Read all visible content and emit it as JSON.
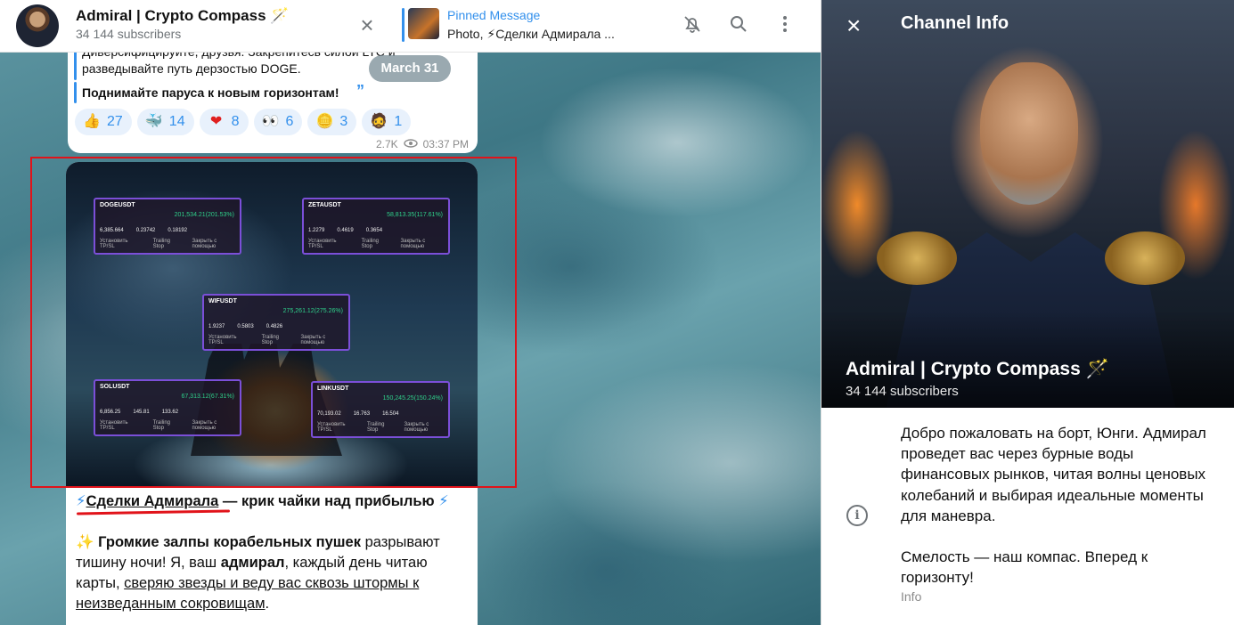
{
  "header": {
    "title": "Admiral | Crypto Compass 🪄",
    "subscribers": "34 144 subscribers",
    "pinned_label": "Pinned Message",
    "pinned_text": "Photo, ⚡Сделки Адмирала ..."
  },
  "message1": {
    "line1": "Диверсифицируйте, друзья. Закрепитесь силой LTC и",
    "line2": "разведывайте путь дерзостью DOGE.",
    "line3": "Поднимайте паруса к новым горизонтам!",
    "date": "March 31",
    "reactions": [
      {
        "icon": "thumbs-up-icon",
        "emoji": "👍",
        "count": "27"
      },
      {
        "icon": "whale-icon",
        "emoji": "🐳",
        "count": "14"
      },
      {
        "icon": "heart-icon",
        "emoji": "❤",
        "count": "8"
      },
      {
        "icon": "eyes-icon",
        "emoji": "👀",
        "count": "6"
      },
      {
        "icon": "coin-icon",
        "emoji": "🪙",
        "count": "3"
      },
      {
        "icon": "admiral-icon",
        "emoji": "🧔",
        "count": "1"
      }
    ],
    "views": "2.7K",
    "time": "03:37 PM"
  },
  "cards": [
    {
      "symbol": "DOGEUSDT",
      "pnl": "201,534.21(201.53%)",
      "v1": "6,385.664",
      "v2": "0.23742",
      "v3": "0.18192",
      "b1": "Установить TP/SL",
      "b2": "Trailing Stop",
      "b3": "Закрыть с помощью"
    },
    {
      "symbol": "ZETAUSDT",
      "pnl": "58,813.35(117.61%)",
      "v1": "1.2279",
      "v2": "0.4619",
      "v3": "0.3654",
      "b1": "Установить TP/SL",
      "b2": "Trailing Stop",
      "b3": "Закрыть с помощью"
    },
    {
      "symbol": "WIFUSDT",
      "pnl": "275,261.12(275.26%)",
      "v1": "1.9237",
      "v2": "0.5803",
      "v3": "0.4826",
      "b1": "Установить TP/SL",
      "b2": "Trailing Stop",
      "b3": "Закрыть с помощью"
    },
    {
      "symbol": "SOLUSDT",
      "pnl": "67,313.12(67.31%)",
      "v1": "6,856.25",
      "v2": "145.81",
      "v3": "133.62",
      "b1": "Установить TP/SL",
      "b2": "Trailing Stop",
      "b3": "Закрыть с помощью"
    },
    {
      "symbol": "LINKUSDT",
      "pnl": "150,245.25(150.24%)",
      "v1": "70,193.02",
      "v2": "16.763",
      "v3": "16.504",
      "b1": "Установить TP/SL",
      "b2": "Trailing Stop",
      "b3": "Закрыть с помощью"
    }
  ],
  "post": {
    "headline_link": "Сделки Адмирала",
    "headline_rest": "— крик чайки над прибылью",
    "para_bold": "Громкие залпы корабельных пушек",
    "para_rest1": "разрывают тишину ночи! Я, ваш",
    "para_bold2": "адмирал",
    "para_rest2": ", каждый день читаю карты,",
    "para_link": "сверяю звезды и веду вас сквозь штормы к неизведанным сокровищам",
    "para_end": "."
  },
  "panel": {
    "title": "Channel Info",
    "hero_title": "Admiral | Crypto Compass 🪄",
    "hero_sub": "34 144 subscribers",
    "info_text": "Добро пожаловать на борт, Юнги. Адмирал проведет вас через бурные воды финансовых рынков, читая волны ценовых колебаний и выбирая идеальные моменты для маневра.\n\nСмелость — наш компас. Вперед к горизонту!",
    "info_label": "Info"
  }
}
